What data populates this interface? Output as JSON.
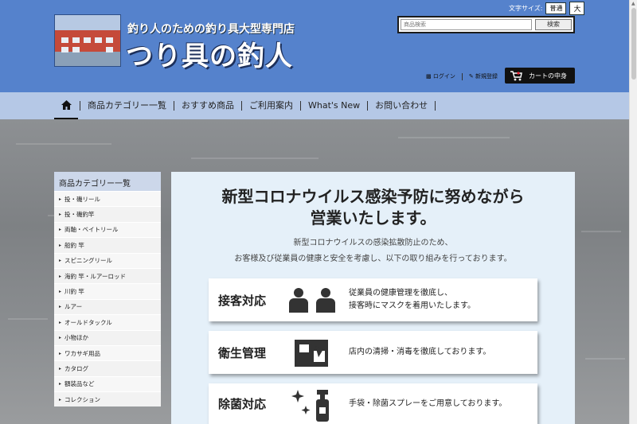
{
  "header": {
    "tagline": "釣り人のための釣り具大型専門店",
    "shop_name": "つり具の釣人",
    "font_size_label": "文字サイズ:",
    "font_size_normal": "普通",
    "font_size_large": "大",
    "search_placeholder": "商品検索",
    "search_button": "検索",
    "login": "ログイン",
    "register": "新規登録",
    "cart": "カートの中身"
  },
  "nav": {
    "items": [
      "商品カテゴリー一覧",
      "おすすめ商品",
      "ご利用案内",
      "What's New",
      "お問い合わせ"
    ]
  },
  "sidebar": {
    "title": "商品カテゴリー一覧",
    "items": [
      "投・磯リール",
      "投・磯釣竿",
      "両軸・ベイトリール",
      "船釣 竿",
      "スピニングリール",
      "海釣 竿・ルアーロッド",
      "川釣 竿",
      "ルアー",
      "オールドタックル",
      "小物ほか",
      "ワカサギ用品",
      "カタログ",
      "額装品など",
      "コレクション"
    ]
  },
  "main": {
    "title_line1": "新型コロナウイルス感染予防に努めながら",
    "title_line2": "営業いたします。",
    "body_line1": "新型コロナウイルスの感染拡散防止のため、",
    "body_line2": "お客様及び従業員の健康と安全を考慮し、以下の取り組みを行っております。",
    "cards": [
      {
        "title": "接客対応",
        "icon": "people-icon",
        "line1": "従業員の健康管理を徹底し、",
        "line2": "接客時にマスクを着用いたします。"
      },
      {
        "title": "衛生管理",
        "icon": "cleaning-icon",
        "line1": "店内の清掃・消毒を徹底しております。",
        "line2": ""
      },
      {
        "title": "除菌対応",
        "icon": "spray-icon",
        "line1": "手袋・除菌スプレーをご用意しております。",
        "line2": ""
      }
    ]
  }
}
